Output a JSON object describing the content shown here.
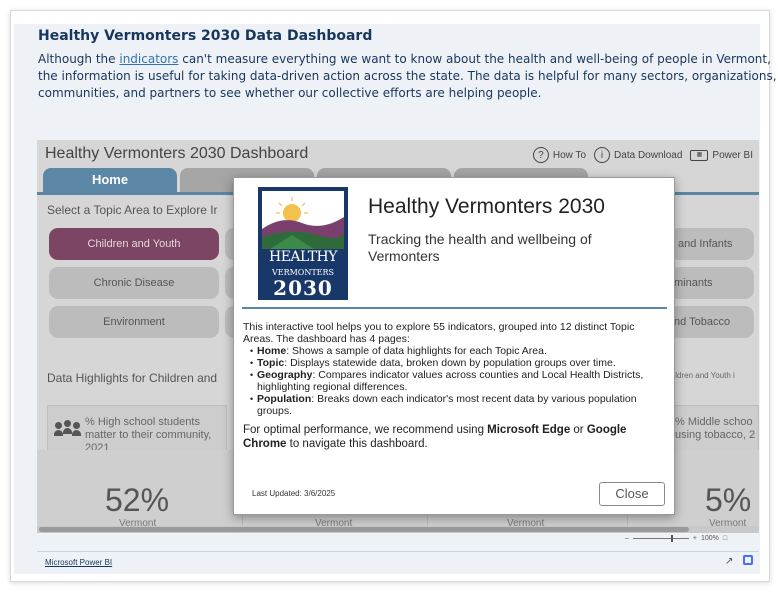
{
  "page": {
    "title": "Healthy Vermonters 2030 Data Dashboard",
    "intro_before_link": "Although the ",
    "intro_link": "indicators",
    "intro_after_link": " can't measure everything we want to know about the health and well-being of people in Vermont, the information is useful for taking data-driven action across the state. The data is helpful for many sectors, organizations, communities, and partners to see whether our collective efforts are helping people."
  },
  "dashboard": {
    "title": "Healthy Vermonters 2030 Dashboard",
    "tools": [
      {
        "icon": "question-circle-icon",
        "glyph": "?",
        "label": "How To"
      },
      {
        "icon": "info-circle-icon",
        "glyph": "i",
        "label": "Data Download"
      },
      {
        "icon": "keyboard-icon",
        "glyph": "",
        "label": "Power BI"
      }
    ],
    "tabs": [
      {
        "label": "Home",
        "active": true
      },
      {
        "label": "",
        "active": false
      },
      {
        "label": "",
        "active": false
      },
      {
        "label": "",
        "active": false
      }
    ],
    "select_label": "Select a Topic Area to Explore Ir",
    "topics_left": [
      "Children and Youth",
      "Chronic Disease",
      "Environment"
    ],
    "topics_right": [
      "and Infants",
      "minants",
      "nd Tobacco"
    ],
    "highlights_label": "Data Highlights for Children and",
    "highlights_right_label": "hildren and Youth i",
    "indicator_left": "% High school students\nmatter to their community,\n2021",
    "indicator_right": "% Middle schoo\nusing tobacco, 2",
    "value_left": "52%",
    "value_right": "5%",
    "sub_labels": [
      "Vermont",
      "Vermont",
      "Vermont",
      "Vermont"
    ],
    "zoom_label": "100%"
  },
  "footer": {
    "powerbi_link": "Microsoft Power BI"
  },
  "modal": {
    "logo_word1": "HEALTHY",
    "logo_word2": "VERMONTERS",
    "logo_word3": "2030",
    "title": "Healthy Vermonters 2030",
    "subtitle": "Tracking the health and wellbeing of Vermonters",
    "body_intro": "This interactive tool helps you to explore 55 indicators, grouped into 12 distinct Topic Areas. The dashboard has 4 pages:",
    "pages": [
      {
        "name": "Home",
        "desc": ": Shows a sample of data highlights for each Topic Area."
      },
      {
        "name": "Topic",
        "desc": ": Displays statewide data, broken down by population groups over time."
      },
      {
        "name": "Geography",
        "desc": ": Compares indicator values across counties and Local Health Districts, highlighting regional differences."
      },
      {
        "name": "Population",
        "desc": ": Breaks down each indicator's most recent data by various population groups."
      }
    ],
    "perf_before": "For optimal performance, we recommend using ",
    "perf_b1": "Microsoft Edge",
    "perf_mid": " or ",
    "perf_b2": "Google Chrome",
    "perf_after": " to navigate this dashboard.",
    "last_updated": "Last Updated: 3/6/2025",
    "close_label": "Close"
  },
  "colors": {
    "title_text": "#17365d",
    "link": "#2e74b5",
    "active_tab": "#5b86a6",
    "selected_topic": "#7c4563",
    "logo_navy": "#19386a"
  }
}
